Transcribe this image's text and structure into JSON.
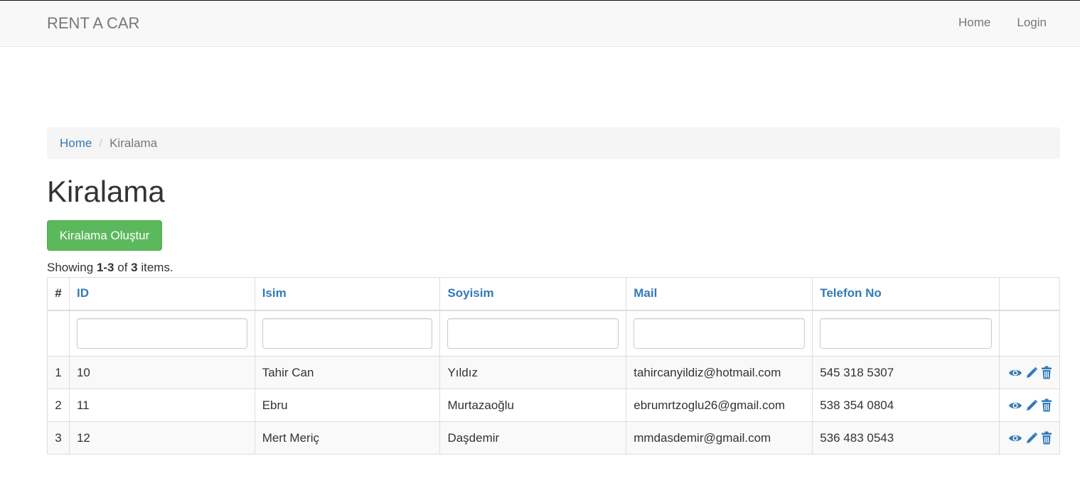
{
  "navbar": {
    "brand": "RENT A CAR",
    "links": [
      "Home",
      "Login"
    ]
  },
  "breadcrumb": {
    "home": "Home",
    "separator": "/",
    "current": "Kiralama"
  },
  "page": {
    "title": "Kiralama",
    "create_button": "Kiralama Oluştur"
  },
  "summary": {
    "prefix": "Showing ",
    "range": "1-3",
    "middle": " of ",
    "total": "3",
    "suffix": " items."
  },
  "table": {
    "columns": [
      "#",
      "ID",
      "Isim",
      "Soyisim",
      "Mail",
      "Telefon No"
    ],
    "rows": [
      {
        "n": "1",
        "id": "10",
        "isim": "Tahir Can",
        "soyisim": "Yıldız",
        "mail": "tahircanyildiz@hotmail.com",
        "telefon": "545 318 5307"
      },
      {
        "n": "2",
        "id": "11",
        "isim": "Ebru",
        "soyisim": "Murtazaoğlu",
        "mail": "ebrumrtzoglu26@gmail.com",
        "telefon": "538 354 0804"
      },
      {
        "n": "3",
        "id": "12",
        "isim": "Mert Meriç",
        "soyisim": "Daşdemir",
        "mail": "mmdasdemir@gmail.com",
        "telefon": "536 483 0543"
      }
    ],
    "row_actions": [
      "eye-icon",
      "pencil-icon",
      "trash-icon"
    ]
  },
  "colors": {
    "link": "#337ab7",
    "success": "#5cb85c",
    "navbar_bg": "#f8f8f8",
    "breadcrumb_bg": "#f5f5f5"
  }
}
